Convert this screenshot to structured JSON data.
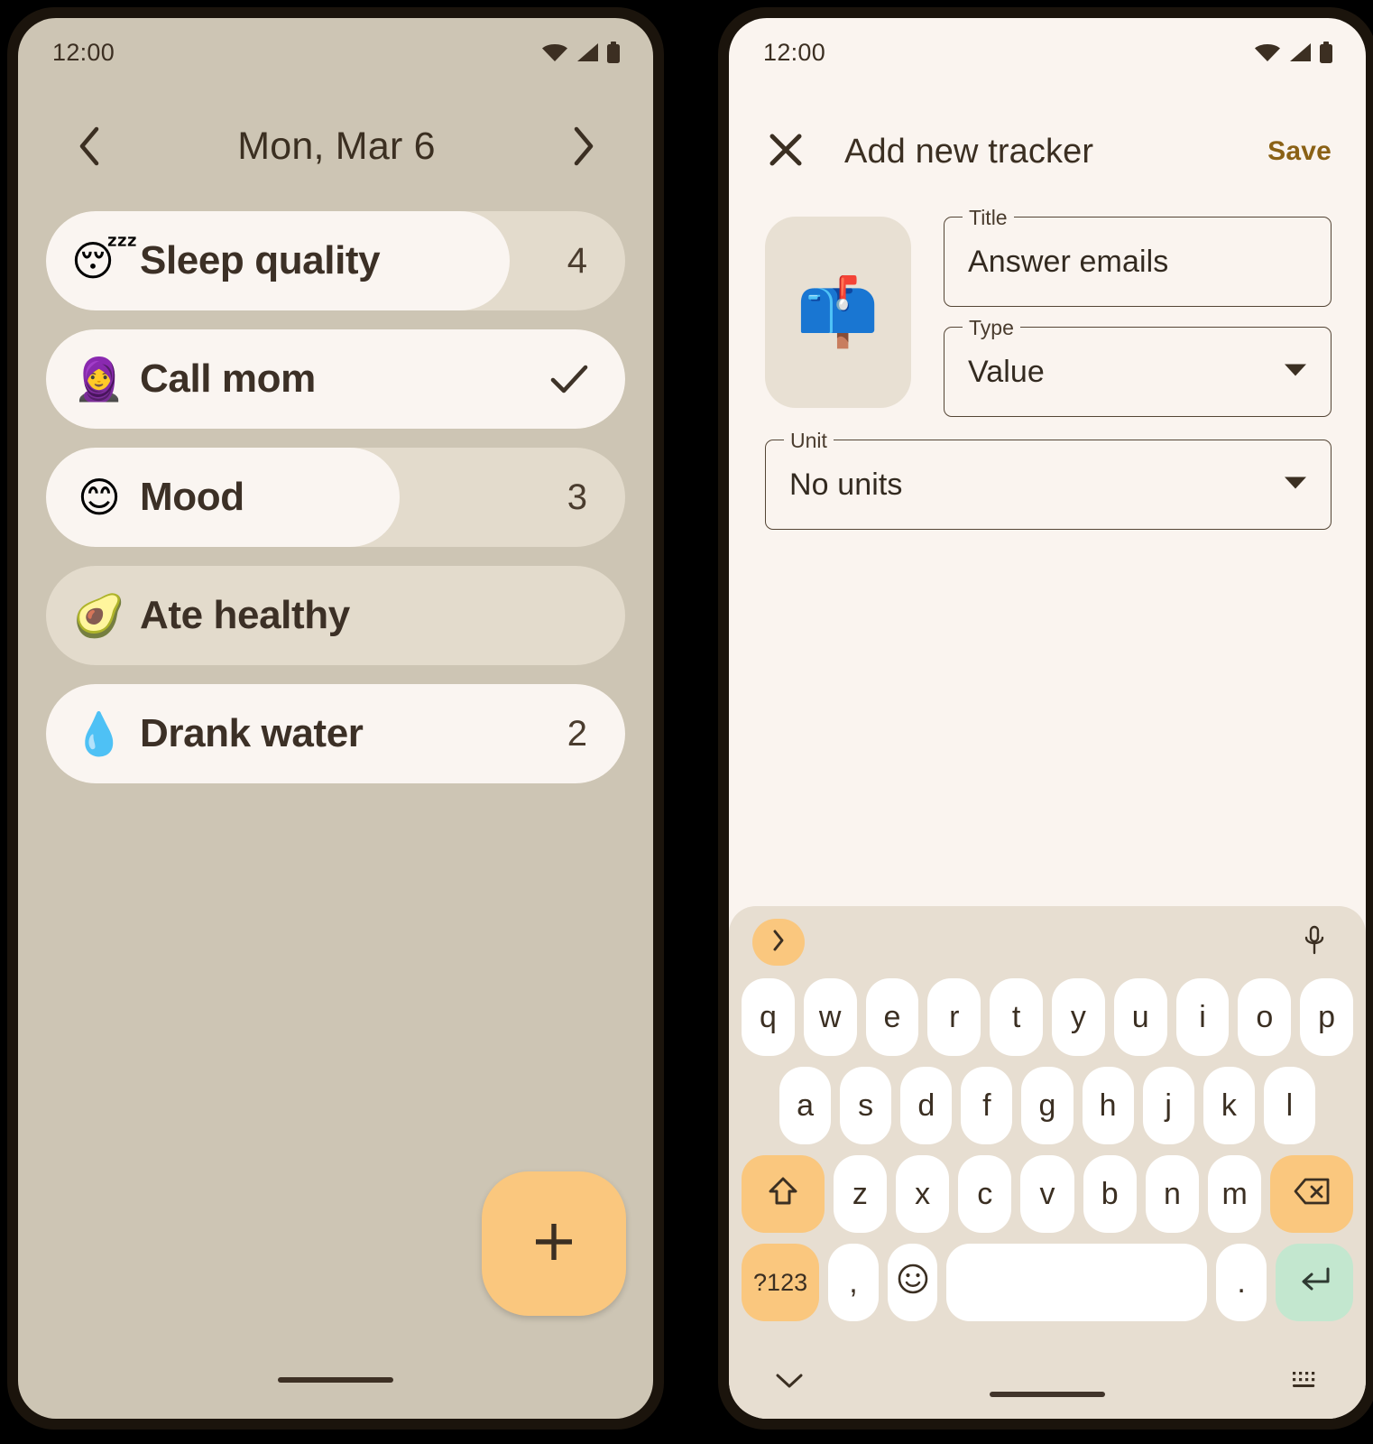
{
  "left_phone": {
    "statusbar": {
      "time": "12:00",
      "icons": [
        "wifi-icon",
        "signal-icon",
        "battery-icon"
      ]
    },
    "date_header": {
      "prev_icon": "chevron-left-icon",
      "title": "Mon, Mar 6",
      "next_icon": "chevron-right-icon"
    },
    "trackers": [
      {
        "emoji": "😴",
        "emoji_name": "sleeping-face-emoji",
        "label": "Sleep quality",
        "value": "4",
        "fill_pct": 80,
        "kind": "value"
      },
      {
        "emoji": "🧕",
        "emoji_name": "woman-with-headscarf-emoji",
        "label": "Call mom",
        "value": "",
        "check_icon": "check-icon",
        "fill_pct": 100,
        "kind": "check"
      },
      {
        "emoji": "😊",
        "emoji_name": "smiling-face-emoji",
        "label": "Mood",
        "value": "3",
        "fill_pct": 61,
        "kind": "value"
      },
      {
        "emoji": "🥑",
        "emoji_name": "avocado-emoji",
        "label": "Ate healthy",
        "value": "",
        "fill_pct": 0,
        "kind": "empty"
      },
      {
        "emoji": "💧",
        "emoji_name": "droplet-emoji",
        "label": "Drank water",
        "value": "2",
        "fill_pct": 100,
        "kind": "value"
      }
    ],
    "fab": {
      "icon": "plus-icon",
      "label": "Add tracker"
    }
  },
  "right_phone": {
    "statusbar": {
      "time": "12:00",
      "icons": [
        "wifi-icon",
        "signal-icon",
        "battery-icon"
      ]
    },
    "appbar": {
      "close_icon": "close-icon",
      "title": "Add new tracker",
      "save_label": "Save"
    },
    "form": {
      "emoji": "📫",
      "emoji_name": "mailbox-emoji",
      "title_field": {
        "label": "Title",
        "value": "Answer emails",
        "placeholder": "Title"
      },
      "type_field": {
        "label": "Type",
        "value": "Value",
        "caret_icon": "caret-down-icon"
      },
      "unit_field": {
        "label": "Unit",
        "value": "No units",
        "caret_icon": "caret-down-icon"
      }
    },
    "keyboard": {
      "toolbar": {
        "expand_icon": "chevron-right-icon",
        "mic_icon": "microphone-icon"
      },
      "row1": [
        "q",
        "w",
        "e",
        "r",
        "t",
        "y",
        "u",
        "i",
        "o",
        "p"
      ],
      "row2": [
        "a",
        "s",
        "d",
        "f",
        "g",
        "h",
        "j",
        "k",
        "l"
      ],
      "row3": [
        "z",
        "x",
        "c",
        "v",
        "b",
        "n",
        "m"
      ],
      "shift_icon": "shift-icon",
      "backspace_icon": "backspace-icon",
      "symbols_label": "?123",
      "comma_label": ",",
      "emoji_icon": "emoji-face-icon",
      "space_label": "",
      "period_label": ".",
      "enter_icon": "enter-icon",
      "bottom": {
        "hide_icon": "chevron-down-icon",
        "switch_icon": "keyboard-switch-icon"
      }
    }
  },
  "theme": {
    "accent_orange": "#fac77e",
    "enter_green": "#c3e7cf",
    "save_gold": "#8a6115",
    "left_bg": "#cdc5b4",
    "right_bg": "#faf4ef",
    "track_bg": "#e3dbcc",
    "fill_bg": "#faf5f1",
    "text_dark": "#3b2f22",
    "keyboard_bg": "#e7ded1"
  }
}
